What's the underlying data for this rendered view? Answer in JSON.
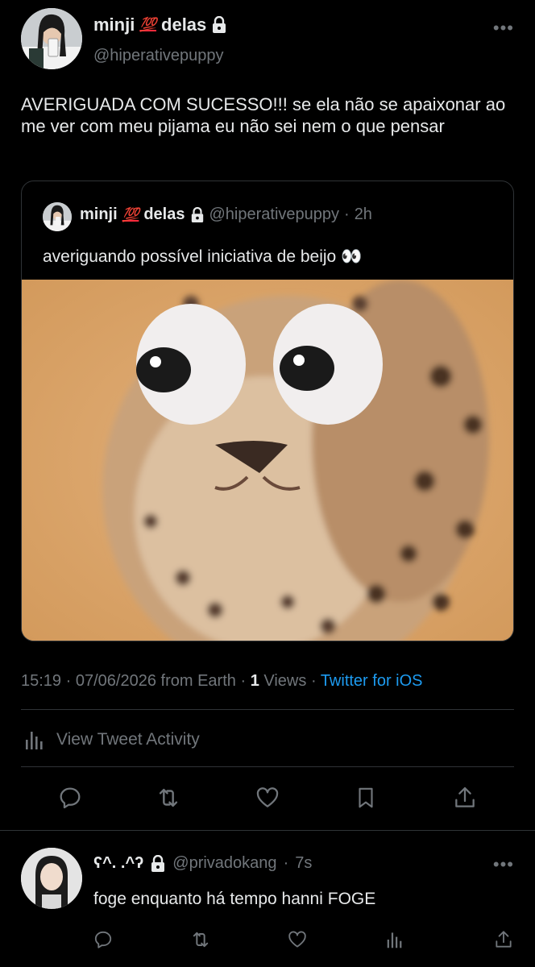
{
  "tweet": {
    "author_name": "minji",
    "emoji_100": "💯",
    "author_name_suffix": "delas",
    "handle": "@hiperativepuppy",
    "more": "•••",
    "text": "AVERIGUADA COM SUCESSO!!! se ela não se apaixonar ao me ver com meu pijama eu não sei nem o que pensar"
  },
  "quote": {
    "author_name": "minji",
    "emoji_100": "💯",
    "author_name_suffix": "delas",
    "handle": "@hiperativepuppy",
    "separator": "·",
    "time": "2h",
    "text": "averiguando possível iniciativa de beijo",
    "text_emoji": "👀"
  },
  "meta": {
    "time": "15:19",
    "date": "07/06/2026",
    "location": "from Earth",
    "views_count": "1",
    "views_label": "Views",
    "client": "Twitter for iOS",
    "separator": "·"
  },
  "activity": {
    "label": "View Tweet Activity"
  },
  "actions": [
    "reply-icon",
    "retweet-icon",
    "like-icon",
    "bookmark-icon",
    "share-icon"
  ],
  "reply": {
    "author_name": "ʕ^. .^ʔ",
    "handle": "@privadokang",
    "separator": "·",
    "time": "7s",
    "more": "•••",
    "text": "foge enquanto há tempo hanni FOGE"
  },
  "colors": {
    "background": "#000000",
    "text": "#e7e9ea",
    "secondary": "#71767b",
    "link": "#1d9bf0",
    "border": "#2f3336"
  }
}
